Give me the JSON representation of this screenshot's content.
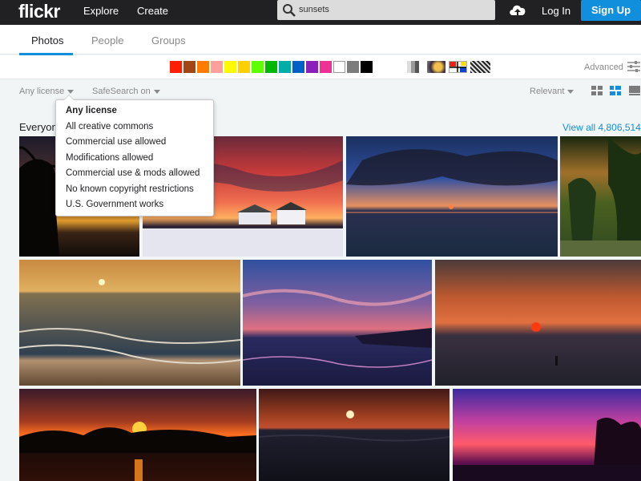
{
  "header": {
    "logo": "flickr",
    "nav": [
      "Explore",
      "Create"
    ],
    "search_value": "sunsets",
    "login": "Log In",
    "signup": "Sign Up"
  },
  "tabs": [
    {
      "label": "Photos",
      "active": true
    },
    {
      "label": "People",
      "active": false
    },
    {
      "label": "Groups",
      "active": false
    }
  ],
  "colors": [
    "#ff2000",
    "#a24615",
    "#ff7c00",
    "#ff9f9c",
    "#fffa00",
    "#ffcf00",
    "#5fff00",
    "#00b800",
    "#00ada7",
    "#0062c6",
    "#8c20ba",
    "#ef3196",
    "#ffffff",
    "#7c7c7c",
    "#000000"
  ],
  "color_filters_extra": [
    "black-and-white",
    "shallow-depth-of-field",
    "minimalism",
    "patterns"
  ],
  "advanced": "Advanced",
  "filters": {
    "license": "Any license",
    "safesearch": "SafeSearch on",
    "sort": "Relevant"
  },
  "section": {
    "heading": "Everyone",
    "view_all": "View all 4,806,514"
  },
  "license_menu": [
    {
      "label": "Any license",
      "selected": true
    },
    {
      "label": "All creative commons",
      "selected": false
    },
    {
      "label": "Commercial use allowed",
      "selected": false
    },
    {
      "label": "Modifications allowed",
      "selected": false
    },
    {
      "label": "Commercial use & mods allowed",
      "selected": false
    },
    {
      "label": "No known copyright restrictions",
      "selected": false
    },
    {
      "label": "U.S. Government works",
      "selected": false
    }
  ]
}
